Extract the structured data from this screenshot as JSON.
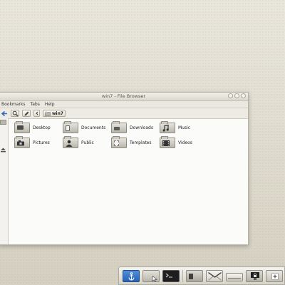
{
  "window": {
    "title": "win7 - File Browser",
    "menu": [
      "Bookmarks",
      "Tabs",
      "Help"
    ],
    "breadcrumb": "win7"
  },
  "folders": [
    {
      "label": "Desktop",
      "icon": "desktop-icon"
    },
    {
      "label": "Documents",
      "icon": "documents-icon"
    },
    {
      "label": "Downloads",
      "icon": "downloads-icon"
    },
    {
      "label": "Music",
      "icon": "music-icon"
    },
    {
      "label": "Pictures",
      "icon": "pictures-icon"
    },
    {
      "label": "Public",
      "icon": "public-icon"
    },
    {
      "label": "Templates",
      "icon": "templates-icon"
    },
    {
      "label": "Videos",
      "icon": "videos-icon"
    }
  ],
  "dock": [
    "anchor-icon",
    "file-manager-icon",
    "terminal-icon",
    "image-viewer-icon",
    "mail-icon",
    "drive-icon",
    "lock-icon",
    "add-icon"
  ],
  "colors": {
    "background": "#e4e0d5",
    "window": "#fbfbfa",
    "accent": "#3a78c8"
  }
}
